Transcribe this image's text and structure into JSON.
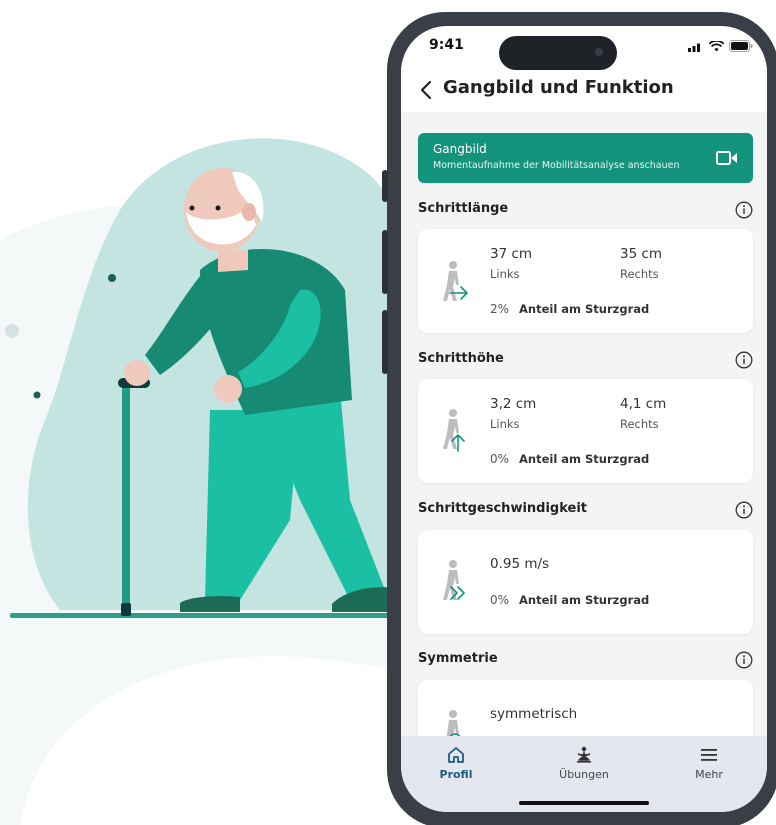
{
  "status_bar": {
    "time": "9:41"
  },
  "header": {
    "title": "Gangbild und Funktion"
  },
  "banner": {
    "title": "Gangbild",
    "subtitle": "Momentaufnahme der Mobilitätsanalyse anschauen"
  },
  "sections": [
    {
      "label": "Schrittlänge",
      "left_value": "37 cm",
      "left_label": "Links",
      "right_value": "35 cm",
      "right_label": "Rechts",
      "percent": "2%",
      "percent_label": "Anteil am Sturzgrad"
    },
    {
      "label": "Schritthöhe",
      "left_value": "3,2 cm",
      "left_label": "Links",
      "right_value": "4,1 cm",
      "right_label": "Rechts",
      "percent": "0%",
      "percent_label": "Anteil am Sturzgrad"
    },
    {
      "label": "Schrittgeschwindigkeit",
      "value": "0.95 m/s",
      "percent": "0%",
      "percent_label": "Anteil am Sturzgrad"
    },
    {
      "label": "Symmetrie",
      "value": "symmetrisch"
    }
  ],
  "tabbar": {
    "items": [
      {
        "label": "Profil",
        "icon": "home-icon",
        "active": true
      },
      {
        "label": "Übungen",
        "icon": "exercise-icon",
        "active": false
      },
      {
        "label": "Mehr",
        "icon": "menu-icon",
        "active": false
      }
    ]
  },
  "colors": {
    "brand_green": "#14937c",
    "light_teal_blob": "#c3e4e1",
    "figure_green": "#17977f",
    "pants_teal": "#1bbfa4",
    "tab_active": "#1b5f7a"
  }
}
